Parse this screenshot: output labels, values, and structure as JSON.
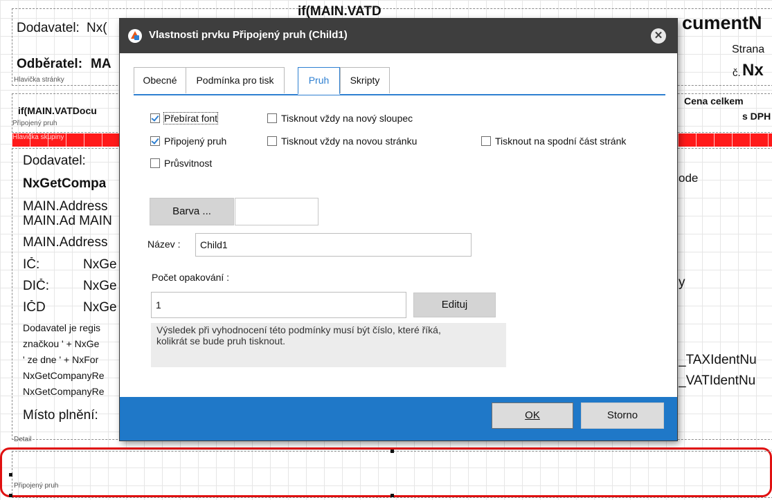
{
  "background": {
    "header_left": {
      "dodavatel_label": "Dodavatel:",
      "dodavatel_value": "Nx(",
      "odberatel": "Odběratel:",
      "odberatel_value": "MA",
      "tiny": "Hlavička stránky"
    },
    "header_mid": "if(MAIN.VATD",
    "header_right": {
      "title": "cumentN",
      "strana": "Strana",
      "cislo_label": "č.",
      "cislo_value": "Nx"
    },
    "band_left_header": "if(MAIN.VATDocu",
    "band_left_tiny": "Připojený pruh",
    "red_band_tiny": "Hlavička skupiny",
    "right_header": [
      "Cena celkem",
      "s DPH"
    ],
    "left_lines": [
      "Dodavatel:",
      "NxGetCompa",
      "MAIN.Address",
      "MAIN.Ad MAIN",
      "MAIN.Address",
      "IČ:",
      "DIČ:",
      "IČD",
      "Dodavatel je regis",
      "značkou ' + NxGe",
      "' ze dne ' + NxFor",
      "NxGetCompanyRe",
      "NxGetCompanyRe",
      "Místo plnění:"
    ],
    "ic_values": [
      "NxGe",
      "NxGe",
      "NxGe"
    ],
    "right_lines": [
      "ode",
      "y",
      "_TAXIdentNu",
      "_VATIdentNu"
    ],
    "detail_tiny": "Detail",
    "bottom_tiny": "Připojený pruh"
  },
  "dialog": {
    "title": "Vlastnosti prvku Připojený pruh (Child1)",
    "close_glyph": "✕",
    "tabs": [
      {
        "label": "Obecné",
        "active": false
      },
      {
        "label": "Podmínka pro tisk",
        "active": false
      },
      {
        "label": "Pruh",
        "active": true
      },
      {
        "label": "Skripty",
        "active": false
      }
    ],
    "options": {
      "prebirat_font": {
        "label": "Přebírat font",
        "checked": true
      },
      "pripojeny_pruh": {
        "label": "Připojený pruh",
        "checked": true
      },
      "prusvitnost": {
        "label": "Průsvitnost",
        "checked": false
      },
      "novy_sloupec": {
        "label": "Tisknout vždy na nový sloupec",
        "checked": false
      },
      "nova_stranka": {
        "label": "Tisknout vždy na novou stránku",
        "checked": false
      },
      "spodni_cast": {
        "label": "Tisknout na spodní část stránk",
        "checked": false
      }
    },
    "barva_button": "Barva ...",
    "nazev_label": "Název :",
    "nazev_value": "Child1",
    "pocet_label": "Počet opakování :",
    "pocet_value": "1",
    "edituj_button": "Edituj",
    "hint_text": "Výsledek při vyhodnocení této podmínky musí být číslo, které říká,\nkolikrát se bude pruh tisknout.",
    "ok_button": "OK",
    "storno_button": "Storno"
  },
  "colors": {
    "accent": "#2d7fd1",
    "titlebar": "#3e3e3e",
    "footer": "#1f78c8",
    "band_red": "#ff1a1a",
    "selection": "#e01010"
  }
}
